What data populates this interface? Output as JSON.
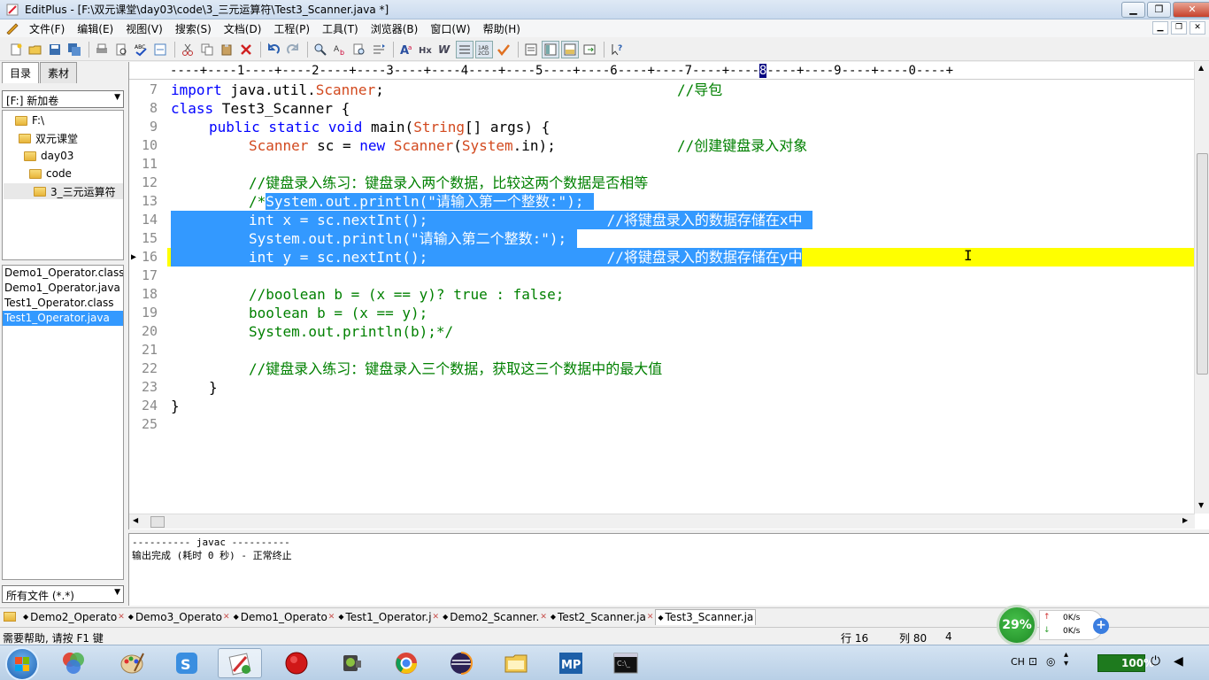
{
  "window": {
    "title": "EditPlus - [F:\\双元课堂\\day03\\code\\3_三元运算符\\Test3_Scanner.java *]",
    "controls": [
      "▁",
      "❐",
      "✕"
    ]
  },
  "menu": {
    "items": [
      "文件(F)",
      "编辑(E)",
      "视图(V)",
      "搜索(S)",
      "文档(D)",
      "工程(P)",
      "工具(T)",
      "浏览器(B)",
      "窗口(W)",
      "帮助(H)"
    ],
    "mdi_controls": [
      "▁",
      "❐",
      "✕"
    ]
  },
  "left_panel": {
    "tabs": [
      "目录",
      "素材"
    ],
    "drive": "[F:] 新加卷",
    "tree": [
      {
        "label": "F:\\",
        "depth": 0
      },
      {
        "label": "双元课堂",
        "depth": 1
      },
      {
        "label": "day03",
        "depth": 2
      },
      {
        "label": "code",
        "depth": 3
      },
      {
        "label": "3_三元运算符",
        "depth": 4
      }
    ],
    "files": [
      "Demo1_Operator.class",
      "Demo1_Operator.java",
      "Test1_Operator.class",
      "Test1_Operator.java"
    ],
    "selected_file_index": 3,
    "filter": "所有文件 (*.*)"
  },
  "editor": {
    "ruler_text": "----+----1----+----2----+----3----+----4----+----5----+----6----+----7----+----",
    "ruler_cursor_col": "8",
    "ruler_rest": "----+----9----+----0----+",
    "line_numbers": [
      "7",
      "8",
      "9",
      "10",
      "11",
      "12",
      "13",
      "14",
      "15",
      "16",
      "17",
      "18",
      "19",
      "20",
      "21",
      "22",
      "23",
      "24",
      "25"
    ],
    "l7_a": "import",
    "l7_b": " java.util.",
    "l7_c": "Scanner",
    "l7_d": ";",
    "l7_comment": "//导包",
    "l8_a": "class",
    "l8_b": " Test3_Scanner {",
    "l9_a": "public static void",
    "l9_b": " main(",
    "l9_c": "String",
    "l9_d": "[] args) {",
    "l10_a": "Scanner",
    "l10_b": " sc = ",
    "l10_c": "new",
    "l10_d": " ",
    "l10_e": "Scanner",
    "l10_f": "(",
    "l10_g": "System",
    "l10_h": ".in);",
    "l10_comment": "//创建键盘录入对象",
    "l12_comment": "//键盘录入练习：键盘录入两个数据，比较这两个数据是否相等",
    "l13_a": "/*",
    "l13_sel": "System.out.println(\"请输入第一个整数:\");",
    "l14_sel": "int x = sc.nextInt();                     //将键盘录入的数据存储在x中",
    "l15_sel": "System.out.println(\"请输入第二个整数:\");",
    "l16_sel": "int y = sc.nextInt();                     //将键盘录入的数据存储在y中",
    "l18": "//boolean b = (x == y)? true : false;",
    "l19": "boolean b = (x == y);",
    "l20": "System.out.println(b);*/",
    "l22_comment": "//键盘录入练习：键盘录入三个数据，获取这三个数据中的最大值",
    "l23": "}",
    "l24": "}"
  },
  "output": {
    "lines": [
      "---------- javac ----------",
      "输出完成 (耗时 0 秒) - 正常终止"
    ]
  },
  "doc_tabs": [
    "Demo2_Operato",
    "Demo3_Operato",
    "Demo1_Operato",
    "Test1_Operator.j",
    "Demo2_Scanner.",
    "Test2_Scanner.ja",
    "Test3_Scanner.ja"
  ],
  "active_doc_tab": 6,
  "status": {
    "help": "需要帮助, 请按 F1 键",
    "row": "行 16",
    "col": "列 80",
    "extra": "4"
  },
  "net": {
    "percent": "29%",
    "up": "0K/s",
    "down": "0K/s"
  },
  "tray": {
    "lang": "CH",
    "battery": "100%"
  },
  "colors": {
    "keyword": "#0000ff",
    "type": "#d2491e",
    "comment": "#008000",
    "selection": "#3399ff",
    "current_line": "#ffff00"
  }
}
